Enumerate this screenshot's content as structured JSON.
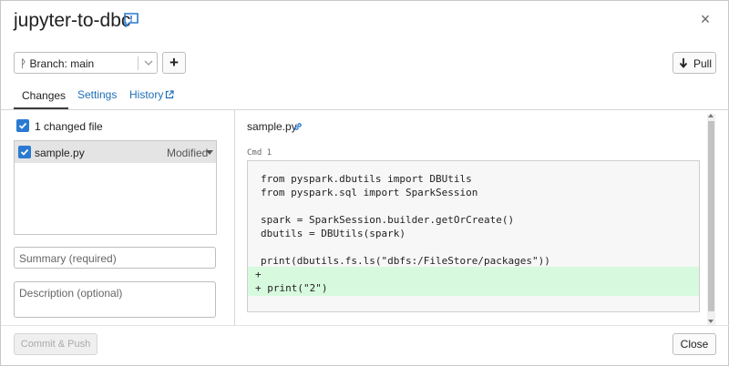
{
  "dialog": {
    "title": "jupyter-to-dbc",
    "close_glyph": "×",
    "feedback_icon": "feedback-icon"
  },
  "toolbar": {
    "branch_label": "ᚹ Branch: main",
    "add_glyph": "+",
    "pull_label": "Pull"
  },
  "tabs": [
    {
      "label": "Changes",
      "active": true
    },
    {
      "label": "Settings",
      "active": false
    },
    {
      "label": "History",
      "active": false,
      "icon": "external-link-icon"
    }
  ],
  "changes": {
    "changed_count_label": "1 changed file",
    "files": [
      {
        "name": "sample.py",
        "status": "Modified",
        "checked": true
      }
    ],
    "summary_placeholder": "Summary (required)",
    "description_placeholder": "Description (optional)",
    "commit_label": "Commit & Push"
  },
  "diff": {
    "file_name": "sample.py",
    "cmd_label": "Cmd 1",
    "lines": [
      "from pyspark.dbutils import DBUtils",
      "from pyspark.sql import SparkSession",
      "",
      "spark = SparkSession.builder.getOrCreate()",
      "dbutils = DBUtils(spark)",
      "",
      "print(dbutils.fs.ls(\"dbfs:/FileStore/packages\"))"
    ],
    "added_lines": [
      "+",
      "+ print(\"2\")"
    ]
  },
  "footer": {
    "close_label": "Close"
  },
  "colors": {
    "accent": "#2a7ad2",
    "link": "#1f6fb7",
    "added_bg": "#d7f9de"
  }
}
